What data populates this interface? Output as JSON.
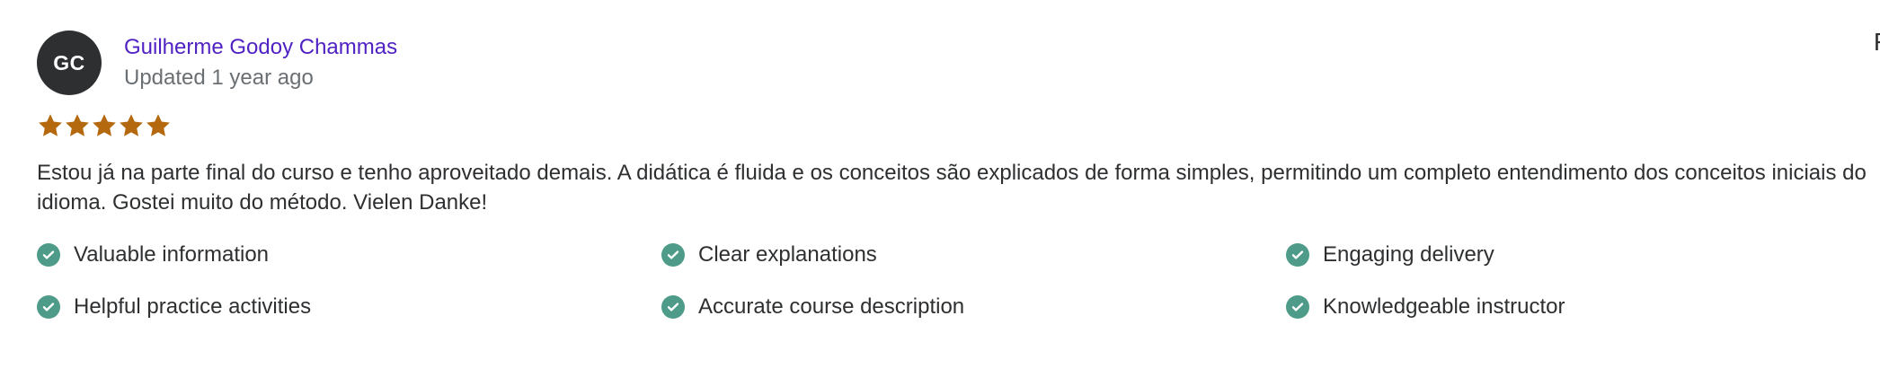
{
  "review": {
    "avatar_initials": "GC",
    "reviewer_name": "Guilherme Godoy Chammas",
    "updated": "Updated 1 year ago",
    "rating": 5,
    "star_color": "#b4690e",
    "comment": "Estou já na parte final do curso e tenho aproveitado demais. A didática é fluida e os conceitos são explicados de forma simples, permitindo um completo entendimento dos conceitos iniciais do idioma. Gostei muito do método. Vielen Danke!",
    "tags": [
      "Valuable information",
      "Clear explanations",
      "Engaging delivery",
      "Helpful practice activities",
      "Accurate course description",
      "Knowledgeable instructor"
    ]
  },
  "corner_text": "F",
  "colors": {
    "link": "#5022c3",
    "avatar_bg": "#2d2f31",
    "check_bg": "#4d9b88",
    "muted_text": "#6a6f73"
  }
}
